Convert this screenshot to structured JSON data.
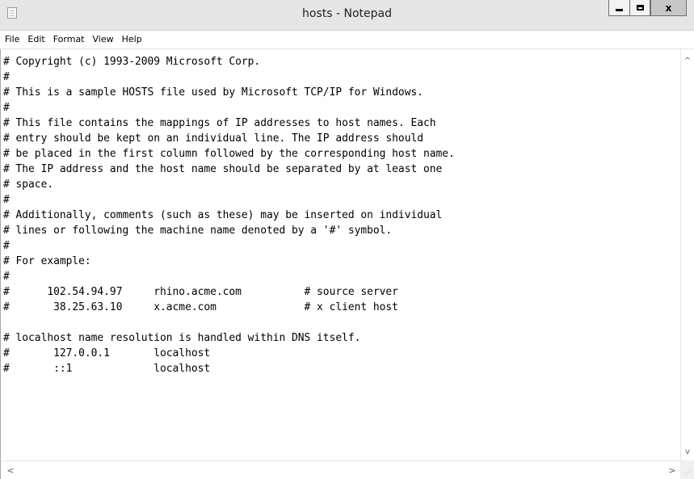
{
  "window": {
    "title": "hosts - Notepad",
    "controls": {
      "minimize": "–",
      "maximize": "□",
      "close": "x"
    }
  },
  "menu": [
    "File",
    "Edit",
    "Format",
    "View",
    "Help"
  ],
  "editor": {
    "lines": [
      "# Copyright (c) 1993-2009 Microsoft Corp.",
      "#",
      "# This is a sample HOSTS file used by Microsoft TCP/IP for Windows.",
      "#",
      "# This file contains the mappings of IP addresses to host names. Each",
      "# entry should be kept on an individual line. The IP address should",
      "# be placed in the first column followed by the corresponding host name.",
      "# The IP address and the host name should be separated by at least one",
      "# space.",
      "#",
      "# Additionally, comments (such as these) may be inserted on individual",
      "# lines or following the machine name denoted by a '#' symbol.",
      "#",
      "# For example:",
      "#",
      "#      102.54.94.97     rhino.acme.com          # source server",
      "#       38.25.63.10     x.acme.com              # x client host",
      "",
      "# localhost name resolution is handled within DNS itself.",
      "#       127.0.0.1       localhost",
      "#       ::1             localhost",
      "",
      "",
      "",
      "",
      ""
    ]
  },
  "scrollbars": {
    "vertical": {
      "up": "^",
      "down": "v"
    },
    "horizontal": {
      "left": "<",
      "right": ">"
    }
  }
}
